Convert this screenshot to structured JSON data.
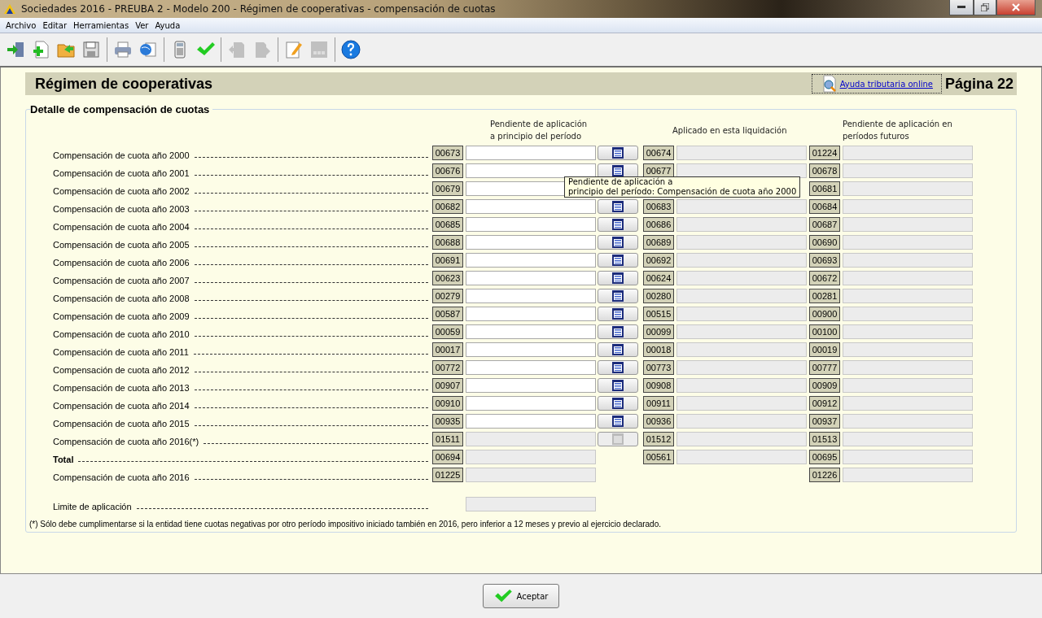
{
  "window": {
    "title": "Sociedades 2016 - PREUBA 2 - Modelo 200 - Régimen de cooperativas - compensación de cuotas"
  },
  "menu": [
    "Archivo",
    "Editar",
    "Herramientas",
    "Ver",
    "Ayuda"
  ],
  "toolbar": [
    {
      "kind": "exit",
      "disabled": false
    },
    {
      "kind": "new",
      "disabled": false
    },
    {
      "kind": "open",
      "disabled": false
    },
    {
      "kind": "save",
      "disabled": false
    },
    {
      "kind": "sep"
    },
    {
      "kind": "print",
      "disabled": false
    },
    {
      "kind": "web",
      "disabled": false
    },
    {
      "kind": "sep"
    },
    {
      "kind": "calc",
      "disabled": false
    },
    {
      "kind": "check",
      "disabled": false
    },
    {
      "kind": "sep"
    },
    {
      "kind": "prev",
      "disabled": true
    },
    {
      "kind": "next",
      "disabled": true
    },
    {
      "kind": "sep"
    },
    {
      "kind": "edit",
      "disabled": false
    },
    {
      "kind": "grid",
      "disabled": true
    },
    {
      "kind": "sep"
    },
    {
      "kind": "help",
      "disabled": false
    }
  ],
  "header": {
    "title": "Régimen de cooperativas",
    "help_link": "Ayuda tributaria online",
    "page": "Página 22"
  },
  "section": {
    "title": "Detalle de compensación de cuotas",
    "columns": [
      "Pendiente de aplicación a principio del período",
      "Aplicado en esta liquidación",
      "Pendiente de aplicación en períodos futuros"
    ],
    "rows": [
      {
        "label": "Compensación de cuota año 2000",
        "bold": false,
        "code_1": "00673",
        "field_1_disabled": false,
        "calc_button": true,
        "calc_disabled": false,
        "code_2": "00674",
        "code_3": "01224"
      },
      {
        "label": "Compensación de cuota año 2001",
        "bold": false,
        "code_1": "00676",
        "field_1_disabled": false,
        "calc_button": true,
        "calc_disabled": false,
        "code_2": "00677",
        "code_3": "00678"
      },
      {
        "label": "Compensación de cuota año 2002",
        "bold": false,
        "code_1": "00679",
        "field_1_disabled": false,
        "code_3": "00681"
      },
      {
        "label": "Compensación de cuota año 2003",
        "bold": false,
        "code_1": "00682",
        "field_1_disabled": false,
        "calc_button": true,
        "calc_disabled": false,
        "code_2": "00683",
        "code_3": "00684"
      },
      {
        "label": "Compensación de cuota año 2004",
        "bold": false,
        "code_1": "00685",
        "field_1_disabled": false,
        "calc_button": true,
        "calc_disabled": false,
        "code_2": "00686",
        "code_3": "00687"
      },
      {
        "label": "Compensación de cuota año 2005",
        "bold": false,
        "code_1": "00688",
        "field_1_disabled": false,
        "calc_button": true,
        "calc_disabled": false,
        "code_2": "00689",
        "code_3": "00690"
      },
      {
        "label": "Compensación de cuota año 2006",
        "bold": false,
        "code_1": "00691",
        "field_1_disabled": false,
        "calc_button": true,
        "calc_disabled": false,
        "code_2": "00692",
        "code_3": "00693"
      },
      {
        "label": "Compensación de cuota año 2007",
        "bold": false,
        "code_1": "00623",
        "field_1_disabled": false,
        "calc_button": true,
        "calc_disabled": false,
        "code_2": "00624",
        "code_3": "00672"
      },
      {
        "label": "Compensación de cuota año 2008",
        "bold": false,
        "code_1": "00279",
        "field_1_disabled": false,
        "calc_button": true,
        "calc_disabled": false,
        "code_2": "00280",
        "code_3": "00281"
      },
      {
        "label": "Compensación de cuota año 2009",
        "bold": false,
        "code_1": "00587",
        "field_1_disabled": false,
        "calc_button": true,
        "calc_disabled": false,
        "code_2": "00515",
        "code_3": "00900"
      },
      {
        "label": "Compensación de cuota año 2010",
        "bold": false,
        "code_1": "00059",
        "field_1_disabled": false,
        "calc_button": true,
        "calc_disabled": false,
        "code_2": "00099",
        "code_3": "00100"
      },
      {
        "label": "Compensación de cuota año 2011",
        "bold": false,
        "code_1": "00017",
        "field_1_disabled": false,
        "calc_button": true,
        "calc_disabled": false,
        "code_2": "00018",
        "code_3": "00019"
      },
      {
        "label": "Compensación de cuota año 2012",
        "bold": false,
        "code_1": "00772",
        "field_1_disabled": false,
        "calc_button": true,
        "calc_disabled": false,
        "code_2": "00773",
        "code_3": "00777"
      },
      {
        "label": "Compensación de cuota año 2013",
        "bold": false,
        "code_1": "00907",
        "field_1_disabled": false,
        "calc_button": true,
        "calc_disabled": false,
        "code_2": "00908",
        "code_3": "00909"
      },
      {
        "label": "Compensación de cuota año 2014",
        "bold": false,
        "code_1": "00910",
        "field_1_disabled": false,
        "calc_button": true,
        "calc_disabled": false,
        "code_2": "00911",
        "code_3": "00912"
      },
      {
        "label": "Compensación de cuota año 2015",
        "bold": false,
        "code_1": "00935",
        "field_1_disabled": false,
        "calc_button": true,
        "calc_disabled": false,
        "code_2": "00936",
        "code_3": "00937"
      },
      {
        "label": "Compensación de cuota año 2016(*)",
        "bold": false,
        "code_1": "01511",
        "field_1_disabled": true,
        "calc_button": true,
        "calc_disabled": true,
        "code_2": "01512",
        "code_3": "01513"
      },
      {
        "label": "Total",
        "bold": true,
        "code_1": "00694",
        "field_1_disabled": true,
        "calc_button": false,
        "code_2": "00561",
        "code_3": "00695"
      },
      {
        "label": "Compensación de cuota año 2016",
        "bold": false,
        "code_1": "01225",
        "field_1_disabled": true,
        "calc_button": false,
        "code_3": "01226"
      },
      {
        "label": "Limite de aplicación",
        "bold": false,
        "field_1_disabled": true,
        "calc_button": false
      }
    ],
    "note": "(*) Sólo debe cumplimentarse si la entidad tiene cuotas negativas por otro período impositivo iniciado también en 2016, pero inferior a 12 meses y previo al ejercicio declarado."
  },
  "tooltip": {
    "lines": [
      "Pendiente de aplicación a",
      "principio del período: Compensación de cuota año 2000"
    ]
  },
  "footer": {
    "button": "Aceptar"
  }
}
